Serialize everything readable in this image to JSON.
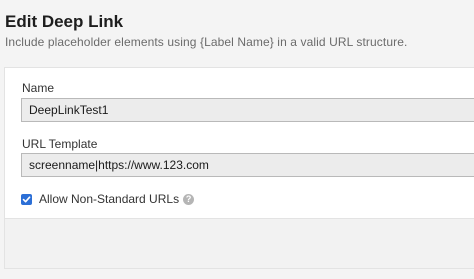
{
  "header": {
    "title": "Edit Deep Link",
    "subtitle": "Include placeholder elements using {Label Name} in a valid URL structure."
  },
  "form": {
    "name": {
      "label": "Name",
      "value": "DeepLinkTest1"
    },
    "url_template": {
      "label": "URL Template",
      "value": "screenname|https://www.123.com"
    },
    "allow_non_standard": {
      "label": "Allow Non-Standard URLs",
      "checked": true,
      "help_glyph": "?"
    }
  },
  "colors": {
    "accent": "#2c6fd6",
    "page_background": "#f4f4f4",
    "input_background": "#ececec"
  },
  "icons": {
    "checkbox": "checkmark-icon",
    "help": "question-mark-icon"
  }
}
